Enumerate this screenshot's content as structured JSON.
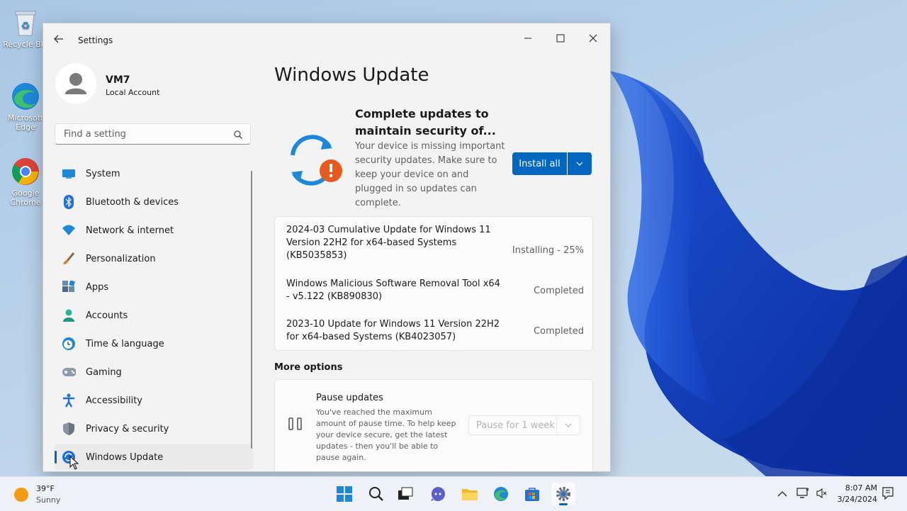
{
  "desktop": {
    "icons": [
      {
        "label": "Recycle Bin",
        "icon": "recycle-bin-icon"
      },
      {
        "label": "Microsoft Edge",
        "icon": "edge-icon"
      },
      {
        "label": "Google Chrome",
        "icon": "chrome-icon"
      }
    ]
  },
  "window": {
    "title": "Settings",
    "controls": {
      "minimize": "minimize-icon",
      "maximize": "maximize-icon",
      "close": "close-icon"
    }
  },
  "sidebar": {
    "user_name": "VM7",
    "account_type": "Local Account",
    "search_placeholder": "Find a setting",
    "items": [
      {
        "label": "System",
        "icon": "system-icon"
      },
      {
        "label": "Bluetooth & devices",
        "icon": "bluetooth-icon"
      },
      {
        "label": "Network & internet",
        "icon": "wifi-icon"
      },
      {
        "label": "Personalization",
        "icon": "brush-icon"
      },
      {
        "label": "Apps",
        "icon": "apps-icon"
      },
      {
        "label": "Accounts",
        "icon": "accounts-icon"
      },
      {
        "label": "Time & language",
        "icon": "time-language-icon"
      },
      {
        "label": "Gaming",
        "icon": "gamepad-icon"
      },
      {
        "label": "Accessibility",
        "icon": "accessibility-icon"
      },
      {
        "label": "Privacy & security",
        "icon": "shield-icon"
      },
      {
        "label": "Windows Update",
        "icon": "windows-update-icon",
        "active": true
      }
    ]
  },
  "main": {
    "title": "Windows Update",
    "alert": {
      "title": "Complete updates to maintain security of...",
      "description": "Your device is missing important security updates. Make sure to keep your device on and plugged in so updates can complete.",
      "install_button": "Install all"
    },
    "updates": [
      {
        "name": "2024-03 Cumulative Update for Windows 11 Version 22H2 for x64-based Systems (KB5035853)",
        "status": "Installing - 25%",
        "progress": 0.25
      },
      {
        "name": "Windows Malicious Software Removal Tool x64 - v5.122 (KB890830)",
        "status": "Completed"
      },
      {
        "name": "2023-10 Update for Windows 11 Version 22H2 for x64-based Systems (KB4023057)",
        "status": "Completed"
      }
    ],
    "more_options_label": "More options",
    "pause": {
      "title": "Pause updates",
      "description": "You've reached the maximum amount of pause time. To help keep your device secure, get the latest updates - then you'll be able to pause again.",
      "dropdown_value": "Pause for 1 week"
    }
  },
  "taskbar": {
    "weather_temp": "39°F",
    "weather_condition": "Sunny",
    "apps": [
      "start-icon",
      "search-icon",
      "task-view-icon",
      "teams-chat-icon",
      "file-explorer-icon",
      "edge-icon",
      "store-icon",
      "settings-icon"
    ],
    "time": "8:07 AM",
    "date": "3/24/2024",
    "colors": {
      "accent": "#0067c0"
    }
  }
}
